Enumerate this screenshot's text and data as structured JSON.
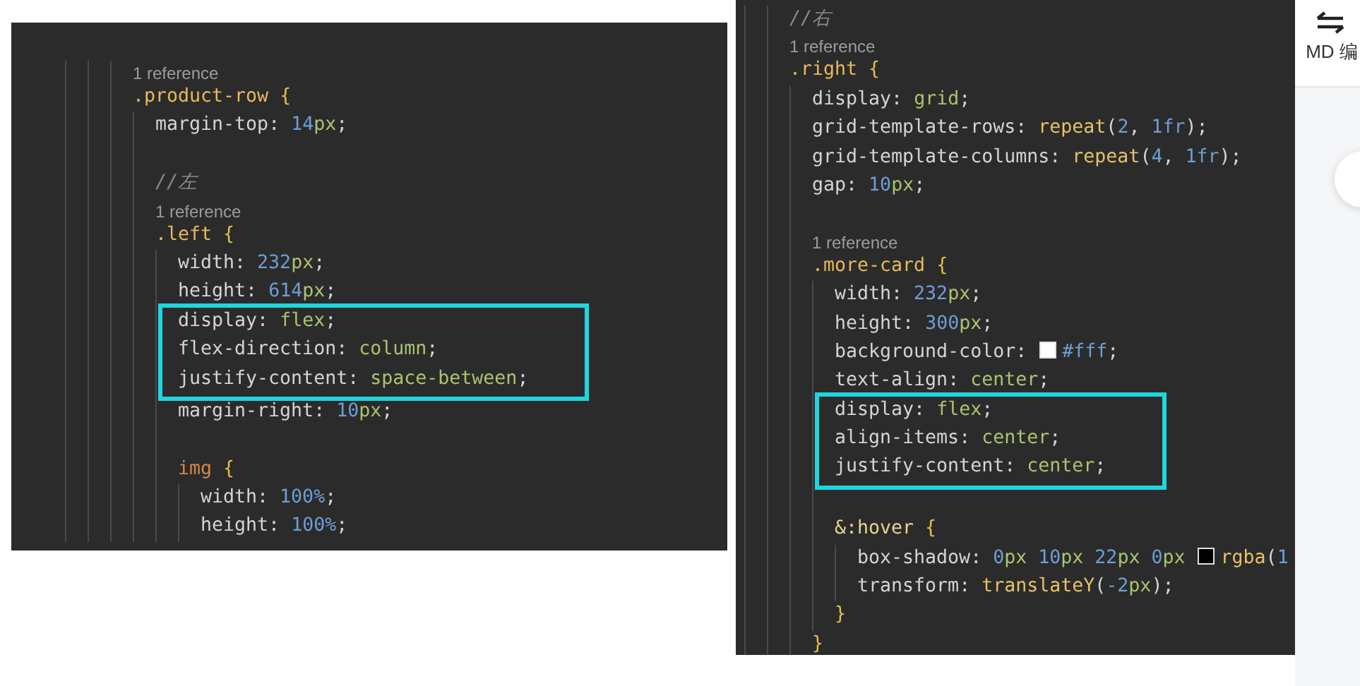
{
  "panels": [
    {
      "items": [
        {
          "kind": "lens",
          "text": "1 reference"
        },
        {
          "kind": "line",
          "tokens": [
            {
              "kind": "selector",
              "text": ".product-row"
            },
            {
              "kind": "brace",
              "text": " {"
            }
          ],
          "children": [
            {
              "kind": "line",
              "tokens": [
                {
                  "kind": "prop",
                  "text": "margin-top"
                },
                {
                  "kind": "punct",
                  "text": ": "
                },
                {
                  "kind": "num",
                  "text": "14"
                },
                {
                  "kind": "unit",
                  "text": "px"
                },
                {
                  "kind": "punct",
                  "text": ";"
                }
              ]
            },
            {
              "kind": "blank"
            },
            {
              "kind": "line",
              "tokens": [
                {
                  "kind": "comment",
                  "text": "//左"
                }
              ]
            },
            {
              "kind": "lens",
              "text": "1 reference"
            },
            {
              "kind": "line",
              "tokens": [
                {
                  "kind": "selector",
                  "text": ".left"
                },
                {
                  "kind": "brace",
                  "text": " {"
                }
              ],
              "children": [
                {
                  "kind": "line",
                  "tokens": [
                    {
                      "kind": "prop",
                      "text": "width"
                    },
                    {
                      "kind": "punct",
                      "text": ": "
                    },
                    {
                      "kind": "num",
                      "text": "232"
                    },
                    {
                      "kind": "unit",
                      "text": "px"
                    },
                    {
                      "kind": "punct",
                      "text": ";"
                    }
                  ]
                },
                {
                  "kind": "line",
                  "tokens": [
                    {
                      "kind": "prop",
                      "text": "height"
                    },
                    {
                      "kind": "punct",
                      "text": ": "
                    },
                    {
                      "kind": "num",
                      "text": "614"
                    },
                    {
                      "kind": "unit",
                      "text": "px"
                    },
                    {
                      "kind": "punct",
                      "text": ";"
                    }
                  ]
                },
                {
                  "kind": "highlight",
                  "lines": [
                    {
                      "tokens": [
                        {
                          "kind": "prop",
                          "text": "display"
                        },
                        {
                          "kind": "punct",
                          "text": ": "
                        },
                        {
                          "kind": "value",
                          "text": "flex"
                        },
                        {
                          "kind": "punct",
                          "text": ";"
                        }
                      ]
                    },
                    {
                      "tokens": [
                        {
                          "kind": "prop",
                          "text": "flex-direction"
                        },
                        {
                          "kind": "punct",
                          "text": ": "
                        },
                        {
                          "kind": "value",
                          "text": "column"
                        },
                        {
                          "kind": "punct",
                          "text": ";"
                        }
                      ]
                    },
                    {
                      "tokens": [
                        {
                          "kind": "prop",
                          "text": "justify-content"
                        },
                        {
                          "kind": "punct",
                          "text": ": "
                        },
                        {
                          "kind": "value",
                          "text": "space-between"
                        },
                        {
                          "kind": "punct",
                          "text": ";"
                        }
                      ]
                    }
                  ]
                },
                {
                  "kind": "line",
                  "tokens": [
                    {
                      "kind": "prop",
                      "text": "margin-right"
                    },
                    {
                      "kind": "punct",
                      "text": ": "
                    },
                    {
                      "kind": "num",
                      "text": "10"
                    },
                    {
                      "kind": "unit",
                      "text": "px"
                    },
                    {
                      "kind": "punct",
                      "text": ";"
                    }
                  ]
                },
                {
                  "kind": "blank"
                },
                {
                  "kind": "line",
                  "tokens": [
                    {
                      "kind": "tag",
                      "text": "img"
                    },
                    {
                      "kind": "brace",
                      "text": " {"
                    }
                  ],
                  "children": [
                    {
                      "kind": "line",
                      "tokens": [
                        {
                          "kind": "prop",
                          "text": "width"
                        },
                        {
                          "kind": "punct",
                          "text": ": "
                        },
                        {
                          "kind": "num",
                          "text": "100%"
                        },
                        {
                          "kind": "punct",
                          "text": ";"
                        }
                      ]
                    },
                    {
                      "kind": "line",
                      "tokens": [
                        {
                          "kind": "prop",
                          "text": "height"
                        },
                        {
                          "kind": "punct",
                          "text": ": "
                        },
                        {
                          "kind": "num",
                          "text": "100%"
                        },
                        {
                          "kind": "punct",
                          "text": ";"
                        }
                      ]
                    }
                  ]
                }
              ]
            }
          ]
        }
      ]
    },
    {
      "items": [
        {
          "kind": "line",
          "tokens": [
            {
              "kind": "comment",
              "text": "//右"
            }
          ]
        },
        {
          "kind": "lens",
          "text": "1 reference"
        },
        {
          "kind": "line",
          "tokens": [
            {
              "kind": "selector",
              "text": ".right"
            },
            {
              "kind": "brace",
              "text": " {"
            }
          ],
          "children": [
            {
              "kind": "line",
              "tokens": [
                {
                  "kind": "prop",
                  "text": "display"
                },
                {
                  "kind": "punct",
                  "text": ": "
                },
                {
                  "kind": "value",
                  "text": "grid"
                },
                {
                  "kind": "punct",
                  "text": ";"
                }
              ]
            },
            {
              "kind": "line",
              "tokens": [
                {
                  "kind": "prop",
                  "text": "grid-template-rows"
                },
                {
                  "kind": "punct",
                  "text": ": "
                },
                {
                  "kind": "fn",
                  "text": "repeat"
                },
                {
                  "kind": "punct",
                  "text": "("
                },
                {
                  "kind": "num",
                  "text": "2"
                },
                {
                  "kind": "punct",
                  "text": ", "
                },
                {
                  "kind": "num",
                  "text": "1fr"
                },
                {
                  "kind": "punct",
                  "text": ");"
                }
              ]
            },
            {
              "kind": "line",
              "tokens": [
                {
                  "kind": "prop",
                  "text": "grid-template-columns"
                },
                {
                  "kind": "punct",
                  "text": ": "
                },
                {
                  "kind": "fn",
                  "text": "repeat"
                },
                {
                  "kind": "punct",
                  "text": "("
                },
                {
                  "kind": "num",
                  "text": "4"
                },
                {
                  "kind": "punct",
                  "text": ", "
                },
                {
                  "kind": "num",
                  "text": "1fr"
                },
                {
                  "kind": "punct",
                  "text": ");"
                }
              ]
            },
            {
              "kind": "line",
              "tokens": [
                {
                  "kind": "prop",
                  "text": "gap"
                },
                {
                  "kind": "punct",
                  "text": ": "
                },
                {
                  "kind": "num",
                  "text": "10"
                },
                {
                  "kind": "unit",
                  "text": "px"
                },
                {
                  "kind": "punct",
                  "text": ";"
                }
              ]
            },
            {
              "kind": "blank"
            },
            {
              "kind": "lens",
              "text": "1 reference"
            },
            {
              "kind": "line",
              "tokens": [
                {
                  "kind": "selector",
                  "text": ".more-card"
                },
                {
                  "kind": "brace",
                  "text": " {"
                }
              ],
              "children": [
                {
                  "kind": "line",
                  "tokens": [
                    {
                      "kind": "prop",
                      "text": "width"
                    },
                    {
                      "kind": "punct",
                      "text": ": "
                    },
                    {
                      "kind": "num",
                      "text": "232"
                    },
                    {
                      "kind": "unit",
                      "text": "px"
                    },
                    {
                      "kind": "punct",
                      "text": ";"
                    }
                  ]
                },
                {
                  "kind": "line",
                  "tokens": [
                    {
                      "kind": "prop",
                      "text": "height"
                    },
                    {
                      "kind": "punct",
                      "text": ": "
                    },
                    {
                      "kind": "num",
                      "text": "300"
                    },
                    {
                      "kind": "unit",
                      "text": "px"
                    },
                    {
                      "kind": "punct",
                      "text": ";"
                    }
                  ]
                },
                {
                  "kind": "line",
                  "tokens": [
                    {
                      "kind": "prop",
                      "text": "background-color"
                    },
                    {
                      "kind": "punct",
                      "text": ": "
                    },
                    {
                      "kind": "swatch",
                      "color": "#ffffff"
                    },
                    {
                      "kind": "num",
                      "text": "#fff"
                    },
                    {
                      "kind": "punct",
                      "text": ";"
                    }
                  ]
                },
                {
                  "kind": "line",
                  "tokens": [
                    {
                      "kind": "prop",
                      "text": "text-align"
                    },
                    {
                      "kind": "punct",
                      "text": ": "
                    },
                    {
                      "kind": "value",
                      "text": "center"
                    },
                    {
                      "kind": "punct",
                      "text": ";"
                    }
                  ]
                },
                {
                  "kind": "highlight",
                  "lines": [
                    {
                      "tokens": [
                        {
                          "kind": "prop",
                          "text": "display"
                        },
                        {
                          "kind": "punct",
                          "text": ": "
                        },
                        {
                          "kind": "value",
                          "text": "flex"
                        },
                        {
                          "kind": "punct",
                          "text": ";"
                        }
                      ]
                    },
                    {
                      "tokens": [
                        {
                          "kind": "prop",
                          "text": "align-items"
                        },
                        {
                          "kind": "punct",
                          "text": ": "
                        },
                        {
                          "kind": "value",
                          "text": "center"
                        },
                        {
                          "kind": "punct",
                          "text": ";"
                        }
                      ]
                    },
                    {
                      "tokens": [
                        {
                          "kind": "prop",
                          "text": "justify-content"
                        },
                        {
                          "kind": "punct",
                          "text": ": "
                        },
                        {
                          "kind": "value",
                          "text": "center"
                        },
                        {
                          "kind": "punct",
                          "text": ";"
                        }
                      ]
                    }
                  ]
                },
                {
                  "kind": "blank"
                },
                {
                  "kind": "line",
                  "tokens": [
                    {
                      "kind": "selector2",
                      "text": "&:hover"
                    },
                    {
                      "kind": "brace",
                      "text": " {"
                    }
                  ],
                  "children": [
                    {
                      "kind": "line",
                      "tokens": [
                        {
                          "kind": "prop",
                          "text": "box-shadow"
                        },
                        {
                          "kind": "punct",
                          "text": ": "
                        },
                        {
                          "kind": "num",
                          "text": "0"
                        },
                        {
                          "kind": "unit",
                          "text": "px "
                        },
                        {
                          "kind": "num",
                          "text": "10"
                        },
                        {
                          "kind": "unit",
                          "text": "px "
                        },
                        {
                          "kind": "num",
                          "text": "22"
                        },
                        {
                          "kind": "unit",
                          "text": "px "
                        },
                        {
                          "kind": "num",
                          "text": "0"
                        },
                        {
                          "kind": "unit",
                          "text": "px "
                        },
                        {
                          "kind": "swatch",
                          "color": "#000000"
                        },
                        {
                          "kind": "fn",
                          "text": "rgba"
                        },
                        {
                          "kind": "punct",
                          "text": "("
                        },
                        {
                          "kind": "num",
                          "text": "1"
                        }
                      ]
                    },
                    {
                      "kind": "line",
                      "tokens": [
                        {
                          "kind": "prop",
                          "text": "transform"
                        },
                        {
                          "kind": "punct",
                          "text": ": "
                        },
                        {
                          "kind": "fn",
                          "text": "translateY"
                        },
                        {
                          "kind": "punct",
                          "text": "("
                        },
                        {
                          "kind": "num",
                          "text": "-2"
                        },
                        {
                          "kind": "unit",
                          "text": "px"
                        },
                        {
                          "kind": "punct",
                          "text": ");"
                        }
                      ]
                    }
                  ]
                },
                {
                  "kind": "line",
                  "tokens": [
                    {
                      "kind": "brace",
                      "text": "}"
                    }
                  ]
                }
              ]
            },
            {
              "kind": "line",
              "tokens": [
                {
                  "kind": "brace",
                  "text": "}"
                }
              ]
            }
          ]
        }
      ]
    }
  ],
  "side": {
    "label": "MD 编"
  }
}
